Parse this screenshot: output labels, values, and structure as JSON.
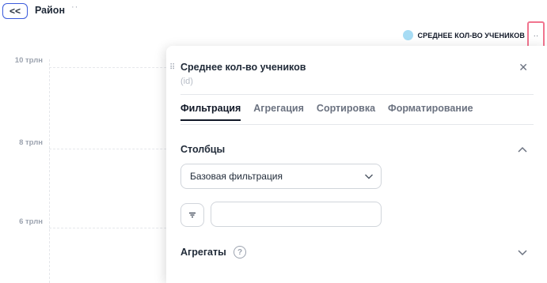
{
  "header": {
    "back_label": "<<",
    "title": "Район",
    "more_label": "··"
  },
  "legend": {
    "label": "СРЕДНЕЕ КОЛ-ВО УЧЕНИКОВ",
    "color": "#a7dcf4",
    "more_label": "··"
  },
  "chart_data": {
    "type": "bar",
    "y_ticks": [
      "10 трлн",
      "8 трлн",
      "6 трлн"
    ],
    "series": [
      {
        "name": "СРЕДНЕЕ КОЛ-ВО УЧЕНИКОВ",
        "values": []
      }
    ]
  },
  "panel": {
    "drag_icon": "⠿",
    "title": "Среднее кол-во учеников",
    "subtitle": "(id)",
    "close_label": "✕",
    "tabs": [
      {
        "label": "Фильтрация",
        "active": true
      },
      {
        "label": "Агрегация",
        "active": false
      },
      {
        "label": "Сортировка",
        "active": false
      },
      {
        "label": "Форматирование",
        "active": false
      }
    ],
    "columns_section": {
      "title": "Столбцы",
      "select_value": "Базовая фильтрация",
      "input_value": "",
      "input_placeholder": ""
    },
    "aggregates_section": {
      "title": "Агрегаты",
      "help_label": "?"
    }
  },
  "colors": {
    "accent": "#3b5bdb",
    "highlight_border": "#f1748e"
  }
}
